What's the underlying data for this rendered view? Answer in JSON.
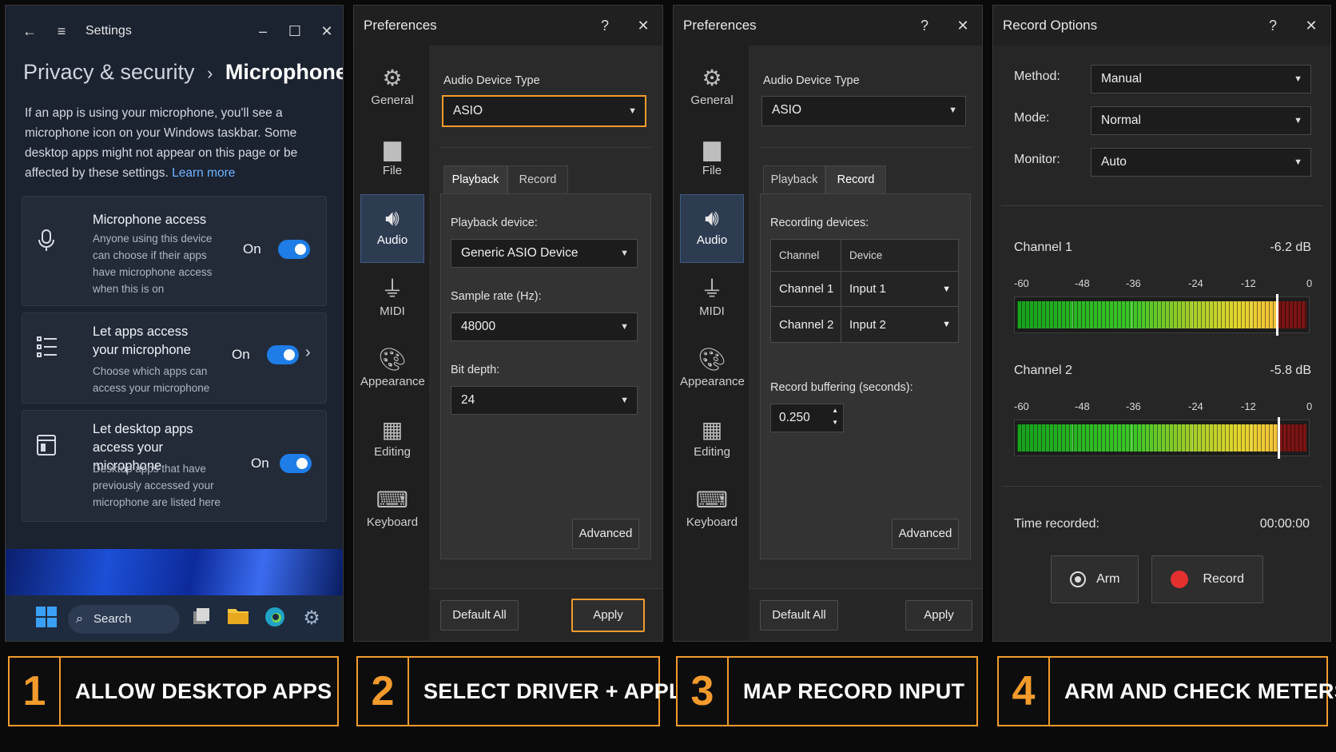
{
  "settings": {
    "title": "Settings",
    "breadcrumb_parent": "Privacy & security",
    "breadcrumb_sep": "›",
    "breadcrumb_current": "Microphone",
    "description": "If an app is using your microphone, you'll see a microphone icon on your Windows taskbar. Some desktop apps might not appear on this page or be affected by these settings.",
    "learn_more": "Learn more",
    "cards": [
      {
        "title": "Microphone access",
        "subtitle": "Anyone using this device can choose if their apps have microphone access when this is on",
        "state": "On",
        "enabled": true
      },
      {
        "title": "Let apps access your microphone",
        "subtitle": "Choose which apps can access your microphone",
        "state": "On",
        "enabled": true
      },
      {
        "title": "Let desktop apps access your microphone",
        "subtitle": "Desktop apps that have previously accessed your microphone are listed here",
        "state": "On",
        "enabled": true
      }
    ],
    "taskbar_search": "Search"
  },
  "pref": {
    "title": "Preferences",
    "help": "?",
    "close": "✕",
    "sidebar": [
      "General",
      "File",
      "Audio",
      "MIDI",
      "Appearance",
      "Editing",
      "Keyboard"
    ],
    "active_sidebar": "Audio",
    "audio_device_type_label": "Audio Device Type",
    "audio_device_type": "ASIO",
    "tabs": [
      "Playback",
      "Record"
    ],
    "playback": {
      "device_label": "Playback device:",
      "device": "Generic ASIO Device",
      "sample_rate_label": "Sample rate (Hz):",
      "sample_rate": "48000",
      "bit_depth_label": "Bit depth:",
      "bit_depth": "24"
    },
    "record": {
      "devices_label": "Recording devices:",
      "columns": [
        "Channel",
        "Device"
      ],
      "rows": [
        {
          "channel": "Channel 1",
          "device": "Input 1"
        },
        {
          "channel": "Channel 2",
          "device": "Input 2"
        }
      ],
      "buffering_label": "Record buffering (seconds):",
      "buffering": "0.250"
    },
    "advanced": "Advanced",
    "default_all": "Default All",
    "apply": "Apply"
  },
  "record_options": {
    "title": "Record Options",
    "method_label": "Method:",
    "method": "Manual",
    "mode_label": "Mode:",
    "mode": "Normal",
    "monitor_label": "Monitor:",
    "monitor": "Auto",
    "scale": [
      "-60",
      "-48",
      "-36",
      "-24",
      "-12",
      "0"
    ],
    "channels": [
      {
        "name": "Channel 1",
        "level": "-6.2 dB",
        "level_db": -6.2
      },
      {
        "name": "Channel 2",
        "level": "-5.8 dB",
        "level_db": -5.8
      }
    ],
    "time_label": "Time recorded:",
    "time": "00:00:00",
    "arm": "Arm",
    "record": "Record"
  },
  "steps": [
    {
      "num": "1",
      "text": "ALLOW DESKTOP APPS"
    },
    {
      "num": "2",
      "text": "SELECT DRIVER + APPLY"
    },
    {
      "num": "3",
      "text": "MAP RECORD INPUT"
    },
    {
      "num": "4",
      "text": "ARM AND CHECK METERS"
    }
  ],
  "colors": {
    "accent": "#f29b2c",
    "toggle": "#1e7de6",
    "record_dot": "#e53030"
  }
}
